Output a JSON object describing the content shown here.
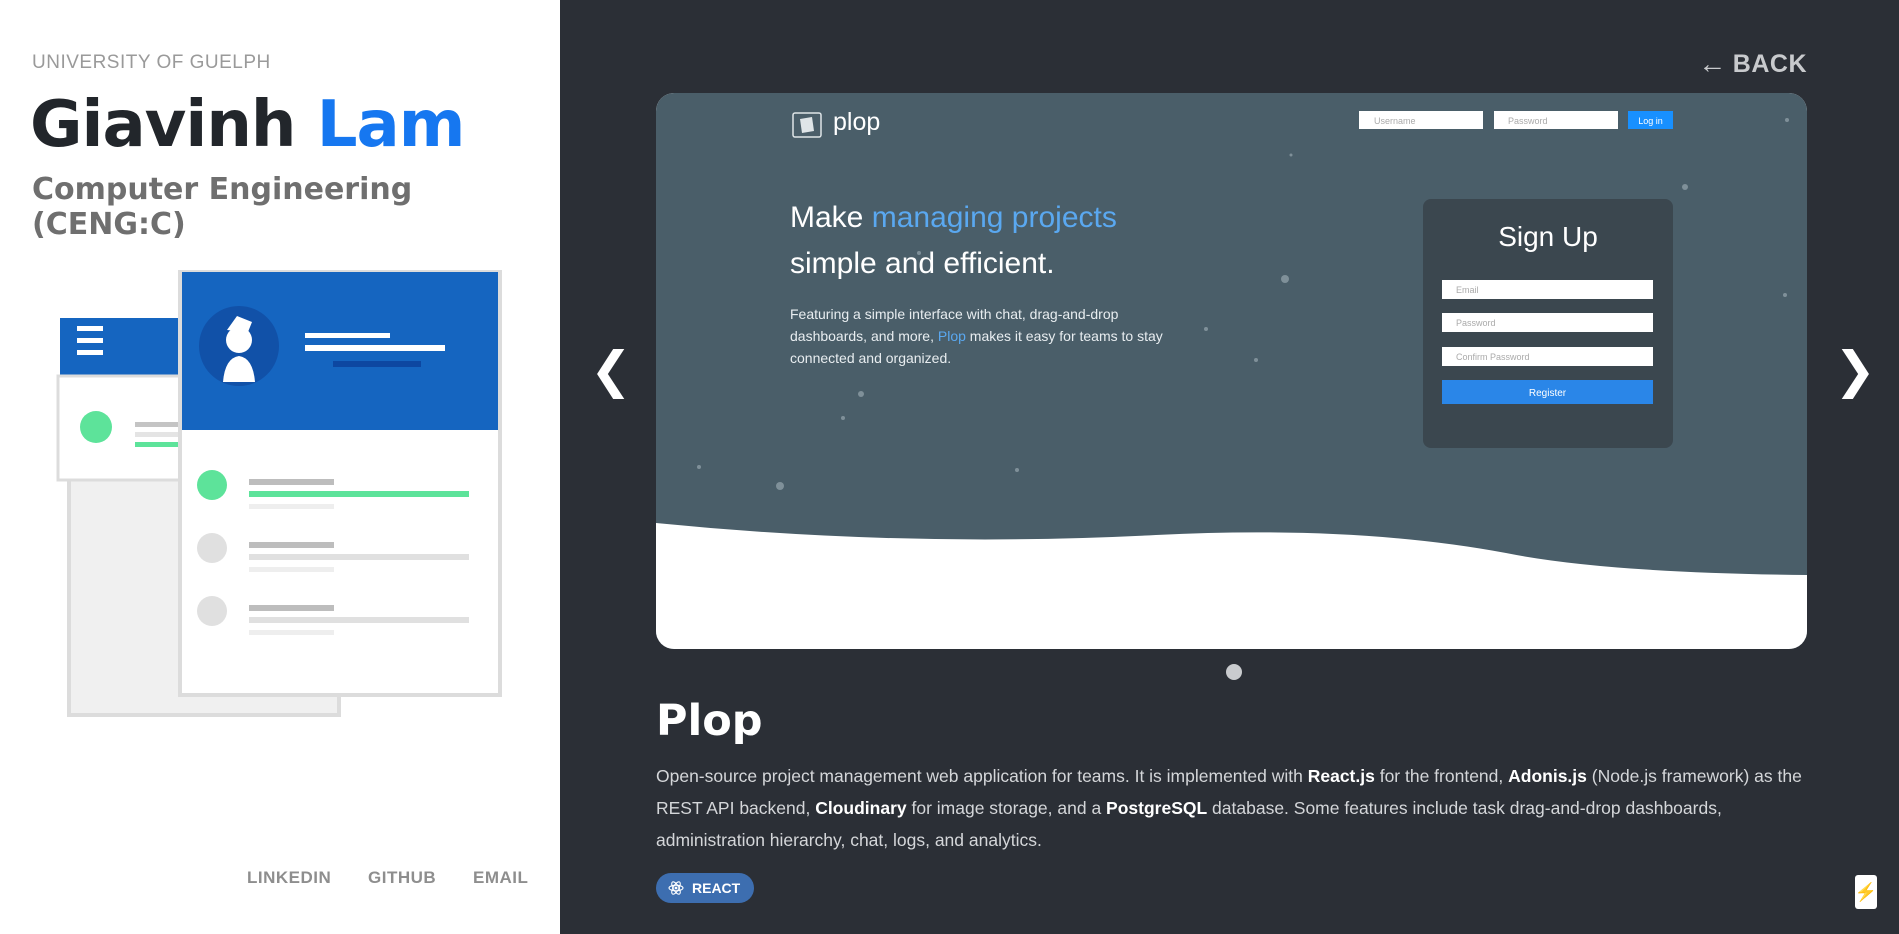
{
  "profile": {
    "university": "UNIVERSITY OF GUELPH",
    "first_name": "Giavinh",
    "last_name": "Lam",
    "program": "Computer Engineering (CENG:C)"
  },
  "social": {
    "linkedin": "LINKEDIN",
    "github": "GITHUB",
    "email": "EMAIL"
  },
  "nav": {
    "back_arrow": "←",
    "back_label": "BACK",
    "prev": "❮",
    "next": "❯"
  },
  "screenshot": {
    "logo": "plop",
    "username_placeholder": "Username",
    "password_placeholder": "Password",
    "login_label": "Log in",
    "hero_make": "Make",
    "hero_highlight": "managing projects",
    "hero_line2": "simple and efficient.",
    "hero_sub_1": "Featuring a simple interface with chat, drag-and-drop",
    "hero_sub_2": "dashboards, and more,",
    "hero_sub_brand": "Plop",
    "hero_sub_3": "makes it easy for teams to stay",
    "hero_sub_4": "connected and organized.",
    "signup_title": "Sign Up",
    "email_placeholder": "Email",
    "pass_placeholder": "Password",
    "confirm_placeholder": "Confirm Password",
    "register_label": "Register"
  },
  "project": {
    "title": "Plop",
    "desc_1": "Open-source project management web application for teams. It is implemented with ",
    "desc_react": "React.js",
    "desc_2": " for the frontend, ",
    "desc_adonis": "Adonis.js",
    "desc_3": " (Node.js framework) as the REST API backend, ",
    "desc_cloud": "Cloudinary",
    "desc_4": " for image storage, and a ",
    "desc_pg": "PostgreSQL",
    "desc_5": " database. Some features include task drag-and-drop dashboards, administration hierarchy, chat, logs, and analytics.",
    "tag": "REACT",
    "tag_icon": "react-icon"
  },
  "colors": {
    "accent_blue": "#1677f0",
    "dark_bg": "#2b2f36",
    "slide_bg": "#4a5e69",
    "green": "#5de39a"
  },
  "carousel": {
    "slide_index": 1,
    "slide_count": 1
  }
}
